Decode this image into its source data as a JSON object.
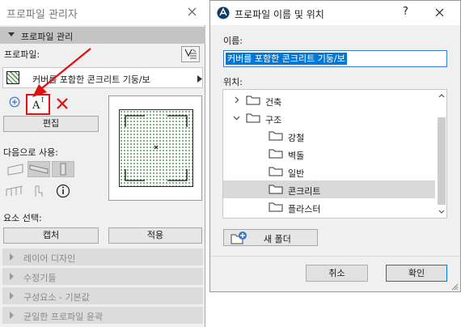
{
  "palette": {
    "title": "프로파일 관리자",
    "section_title": "프로파일 관리",
    "profile_label": "프로파일:",
    "profile_name": "커버를 포함한 콘크리트 기둥/보",
    "edit_label": "편집",
    "use_as_label": "다음으로 사용:",
    "element_select_label": "요소 선택:",
    "capture_label": "캡처",
    "apply_label": "적용",
    "collapsed_sections": [
      "레이어 디자인",
      "수정기들",
      "구성요소 - 기본값",
      "균일한 프로파일 윤곽"
    ]
  },
  "dialog": {
    "title": "프로파일 이름 및 위치",
    "help_glyph": "?",
    "name_label": "이름:",
    "name_value": "커버를 포함한 콘크리트 기둥/보",
    "location_label": "위치:",
    "tree": [
      {
        "label": "건축",
        "depth": 0,
        "expanded": false,
        "selected": false
      },
      {
        "label": "구조",
        "depth": 0,
        "expanded": true,
        "selected": false
      },
      {
        "label": "강철",
        "depth": 1,
        "expanded": false,
        "selected": false
      },
      {
        "label": "벽돌",
        "depth": 1,
        "expanded": false,
        "selected": false
      },
      {
        "label": "일반",
        "depth": 1,
        "expanded": false,
        "selected": false
      },
      {
        "label": "콘크리트",
        "depth": 1,
        "expanded": false,
        "selected": true
      },
      {
        "label": "플라스터",
        "depth": 1,
        "expanded": false,
        "selected": false
      }
    ],
    "new_folder_label": "새 폴더",
    "cancel_label": "취소",
    "ok_label": "확인"
  },
  "colors": {
    "annotation_red": "#e01010",
    "selection_blue": "#0078d7",
    "hatch_green": "#5c9c5c"
  }
}
